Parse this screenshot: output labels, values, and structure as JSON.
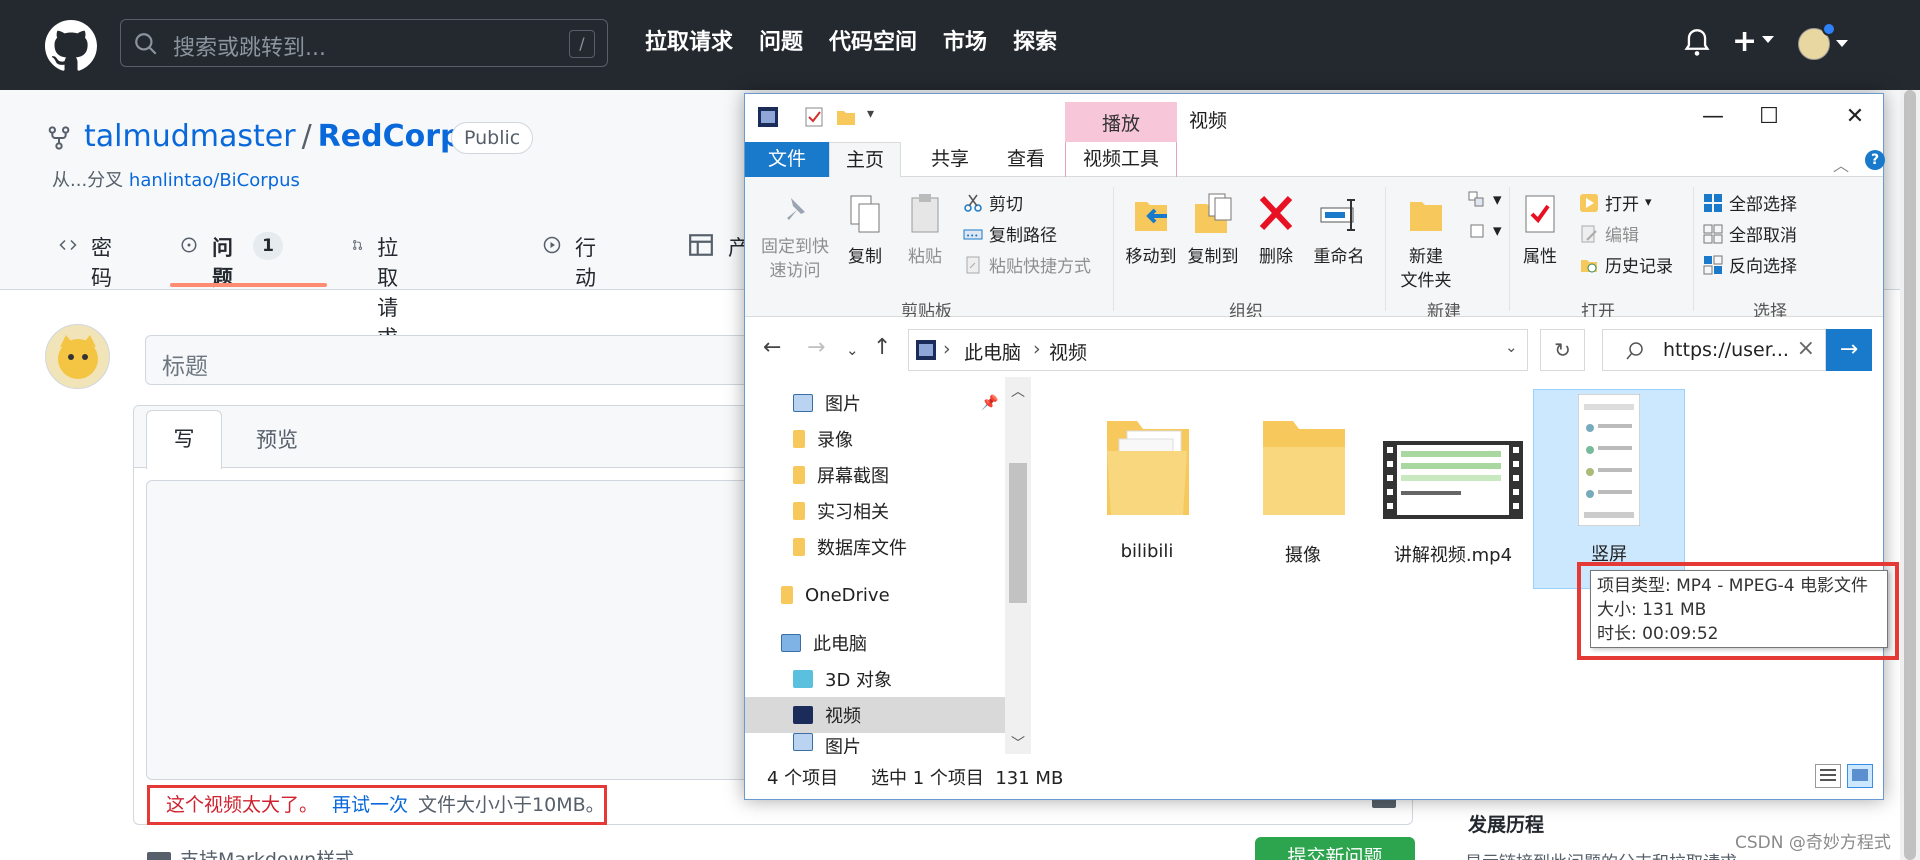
{
  "github": {
    "search_placeholder": "搜索或跳转到...",
    "search_kbd": "/",
    "nav": [
      "拉取请求",
      "问题",
      "代码空间",
      "市场",
      "探索"
    ],
    "plus": "+"
  },
  "repo": {
    "owner": "talmudmaster",
    "sep": "/",
    "name": "RedCorpus",
    "visibility": "Public",
    "fork_prefix": "从...分叉",
    "fork_source": "hanlintao/BiCorpus",
    "tabs": [
      {
        "label": "密码",
        "icon": "code-icon"
      },
      {
        "label": "问题",
        "icon": "issue-icon",
        "count": "1"
      },
      {
        "label": "拉取请求",
        "icon": "pull-request-icon"
      },
      {
        "label": "行动",
        "icon": "play-icon"
      },
      {
        "label": "产",
        "icon": "table-icon"
      }
    ]
  },
  "issue": {
    "title_placeholder": "标题",
    "tab_write": "写",
    "tab_preview": "预览",
    "error_msg": "这个视频太大了。",
    "retry": "再试一次",
    "size_hint": "文件大小小于10MB。",
    "markdown_hint": "支持Markdown样式",
    "submit_label": "提交新问题",
    "side_heading": "发展历程",
    "side_text": "显示链接到此问题的分支和拉取请求"
  },
  "explorer": {
    "window_title": "视频",
    "contextual_tab": "播放",
    "menu": {
      "file": "文件",
      "home": "主页",
      "share": "共享",
      "view": "查看",
      "video_tools": "视频工具"
    },
    "ribbon": {
      "pin": "固定到快速访问",
      "pin_line1": "固定到快",
      "pin_line2": "速访问",
      "copy": "复制",
      "paste": "粘贴",
      "cut": "剪切",
      "copy_path": "复制路径",
      "paste_shortcut": "粘贴快捷方式",
      "clipboard_group": "剪贴板",
      "move_to": "移动到",
      "copy_to": "复制到",
      "delete": "删除",
      "rename": "重命名",
      "organize_group": "组织",
      "new_folder_line1": "新建",
      "new_folder_line2": "文件夹",
      "new_group": "新建",
      "properties": "属性",
      "open": "打开",
      "edit": "编辑",
      "history": "历史记录",
      "open_group": "打开",
      "select_all": "全部选择",
      "select_none": "全部取消",
      "invert": "反向选择",
      "select_group": "选择"
    },
    "address": {
      "crumbs": [
        "此电脑",
        "视频"
      ]
    },
    "search_value": "https://user...",
    "nav_items": [
      {
        "label": "图片",
        "kind": "pictures",
        "pinned": true
      },
      {
        "label": "录像",
        "kind": "folder"
      },
      {
        "label": "屏幕截图",
        "kind": "folder"
      },
      {
        "label": "实习相关",
        "kind": "folder"
      },
      {
        "label": "数据库文件",
        "kind": "folder"
      },
      {
        "label": "OneDrive",
        "kind": "folder"
      },
      {
        "label": "此电脑",
        "kind": "computer"
      },
      {
        "label": "3D 对象",
        "kind": "3d"
      },
      {
        "label": "视频",
        "kind": "video",
        "selected": true
      },
      {
        "label": "图片",
        "kind": "pictures"
      }
    ],
    "files": [
      {
        "name": "bilibili",
        "kind": "folder-with-docs"
      },
      {
        "name": "摄像",
        "kind": "folder"
      },
      {
        "name": "讲解视频.mp4",
        "kind": "video-thumb"
      },
      {
        "name": "竖屏",
        "kind": "video-vertical",
        "selected": true
      }
    ],
    "tooltip": {
      "type": "项目类型: MP4 - MPEG-4 电影文件",
      "size": "大小: 131 MB",
      "duration": "时长: 00:09:52"
    },
    "status": {
      "count": "4 个项目",
      "selected": "选中 1 个项目  131 MB"
    }
  },
  "watermark": "CSDN @奇妙方程式",
  "colors": {
    "accent_blue": "#1979ca",
    "error_red": "#e53935",
    "github_dark": "#24292f",
    "playback_pink": "#f7c6d8"
  }
}
